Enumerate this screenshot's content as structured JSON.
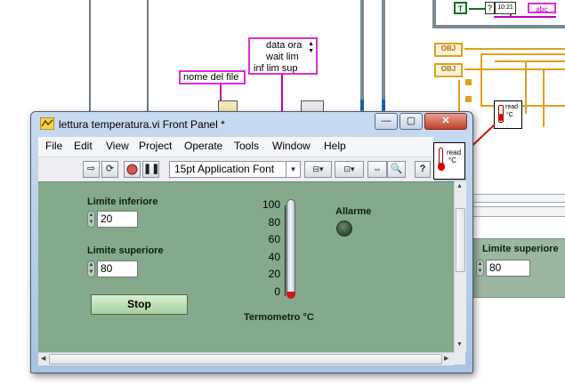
{
  "block_diagram": {
    "const_list": [
      "data ora",
      "wait lim",
      "inf lim sup"
    ],
    "const_filename": "nome del file",
    "node_t": "T",
    "node_time": "10:21",
    "node_abc": "abc",
    "node_obj1": "OBJ",
    "node_obj2": "OBJ",
    "node_read_lines": [
      "read",
      "°C"
    ],
    "bg_label": "Limite superiore",
    "bg_value": "80"
  },
  "window": {
    "title": "lettura temperatura.vi Front Panel *",
    "caption_buttons": [
      "—",
      "▢",
      "✕"
    ]
  },
  "menu": [
    "File",
    "Edit",
    "View",
    "Project",
    "Operate",
    "Tools",
    "Window",
    "Help"
  ],
  "toolbar": {
    "font": "15pt Application Font"
  },
  "vi_icon": {
    "lines": [
      "read",
      "°C"
    ]
  },
  "panel": {
    "limite_inferiore": {
      "label": "Limite inferiore",
      "value": "20"
    },
    "limite_superiore": {
      "label": "Limite superiore",
      "value": "80"
    },
    "stop": "Stop",
    "thermometer": {
      "label": "Termometro °C",
      "ticks": [
        "100",
        "80",
        "60",
        "40",
        "20",
        "0"
      ],
      "level_fraction": 0.0
    },
    "alarm": {
      "label": "Allarme",
      "state": "off"
    }
  },
  "colors": {
    "panel_bg": "#85a98b",
    "wire_pink": "#c000c0",
    "wire_orange": "#e0a020"
  }
}
